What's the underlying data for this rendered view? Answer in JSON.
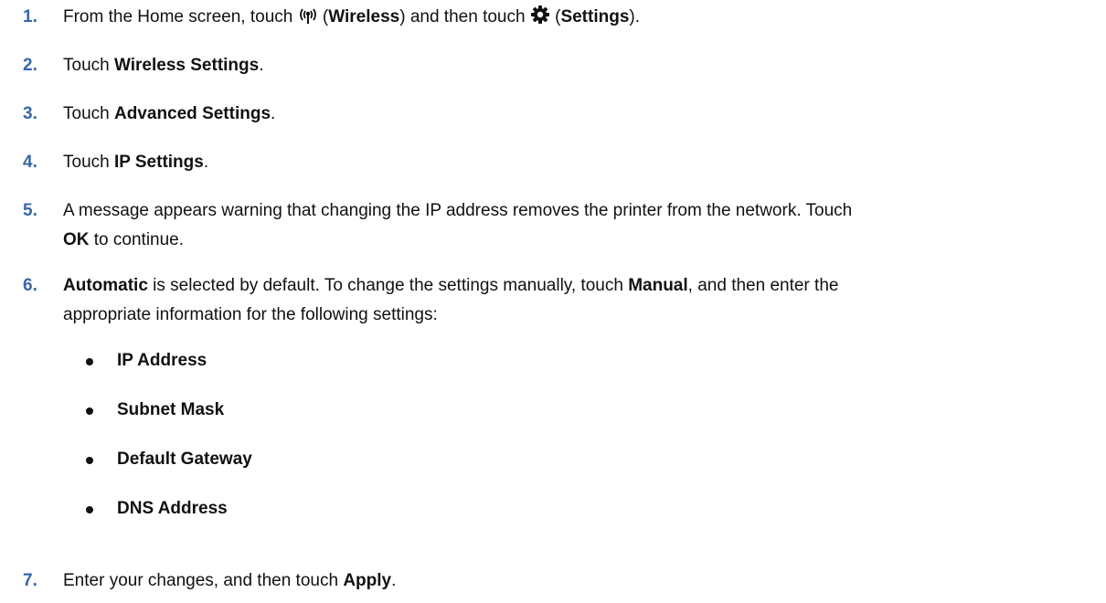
{
  "accent_color": "#3a66a6",
  "steps": [
    {
      "number": "1.",
      "parts": [
        "From the Home screen, touch ",
        " (",
        "Wireless",
        ") and then touch ",
        " (",
        "Settings",
        ")."
      ],
      "icons": [
        "wireless-icon",
        "gear-icon"
      ]
    },
    {
      "number": "2.",
      "prefix": "Touch ",
      "bold": "Wireless Settings",
      "suffix": "."
    },
    {
      "number": "3.",
      "prefix": "Touch ",
      "bold": "Advanced Settings",
      "suffix": "."
    },
    {
      "number": "4.",
      "prefix": "Touch ",
      "bold": "IP Settings",
      "suffix": "."
    },
    {
      "number": "5.",
      "line1": "A message appears warning that changing the IP address removes the printer from the network. Touch",
      "bold": "OK",
      "suffix": " to continue."
    },
    {
      "number": "6.",
      "bold1": "Automatic",
      "mid": " is selected by default. To change the settings manually, touch ",
      "bold2": "Manual",
      "end": ", and then enter the",
      "line2": "appropriate information for the following settings:",
      "bullets": [
        "IP Address",
        "Subnet Mask",
        "Default Gateway",
        "DNS Address"
      ]
    },
    {
      "number": "7.",
      "prefix": "Enter your changes, and then touch ",
      "bold": "Apply",
      "suffix": "."
    }
  ]
}
